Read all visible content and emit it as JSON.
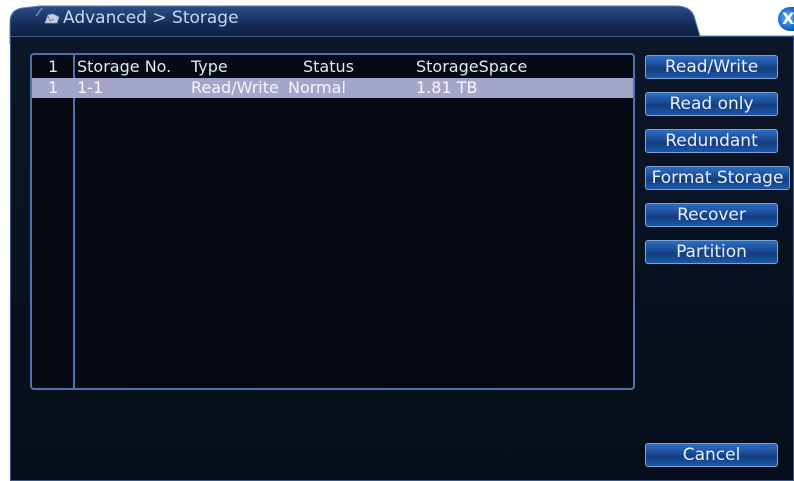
{
  "window": {
    "title": "Advanced > Storage",
    "close_label": "X"
  },
  "table": {
    "header": {
      "index": "1",
      "storage_no": "Storage No.",
      "type": "Type",
      "status": "Status",
      "space": "StorageSpace"
    },
    "rows": [
      {
        "index": "1",
        "storage_no": "1-1",
        "type": "Read/Write",
        "status": "Normal",
        "space": "1.81 TB"
      }
    ]
  },
  "buttons": {
    "read_write": "Read/Write",
    "read_only": "Read only",
    "redundant": "Redundant",
    "format_storage": "Format Storage",
    "recover": "Recover",
    "partition": "Partition",
    "cancel": "Cancel"
  },
  "colors": {
    "accent": "#1a4a92",
    "selected_row": "#a3a6c9",
    "panel_bg": "#070d1a"
  }
}
